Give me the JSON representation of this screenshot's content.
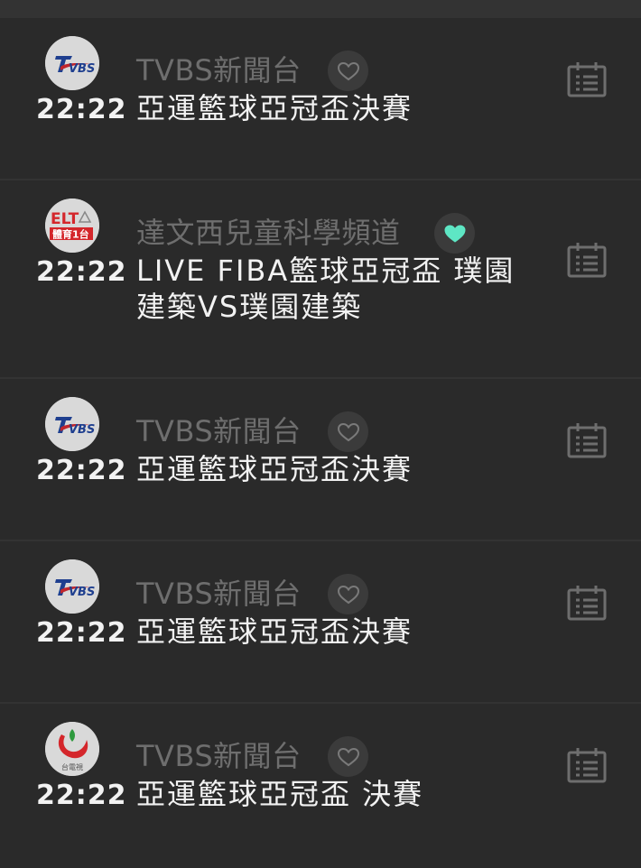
{
  "colors": {
    "background": "#2a2a2a",
    "favorite_active": "#5ee6c4",
    "favorite_inactive": "#7a7a7a",
    "channel_text": "#6e6e6e",
    "primary_text": "#f2f2f2"
  },
  "programs": [
    {
      "logo": "tvbs-logo",
      "channel": "TVBS新聞台",
      "favorite": false,
      "time": "22:22",
      "title": "亞運籃球亞冠盃決賽"
    },
    {
      "logo": "elta-sports-1-logo",
      "logo_text_top": "ELT",
      "logo_text_bottom": "體育1台",
      "channel": "達文西兒童科學頻道",
      "favorite": true,
      "time": "22:22",
      "title": "LIVE FIBA籃球亞冠盃 璞園建築VS璞園建築"
    },
    {
      "logo": "tvbs-logo",
      "channel": "TVBS新聞台",
      "favorite": false,
      "time": "22:22",
      "title": "亞運籃球亞冠盃決賽"
    },
    {
      "logo": "tvbs-logo",
      "channel": "TVBS新聞台",
      "favorite": false,
      "time": "22:22",
      "title": "亞運籃球亞冠盃決賽"
    },
    {
      "logo": "ttv-logo",
      "logo_text": "台電視",
      "channel": "TVBS新聞台",
      "favorite": false,
      "time": "22:22",
      "title": "亞運籃球亞冠盃 決賽"
    }
  ]
}
